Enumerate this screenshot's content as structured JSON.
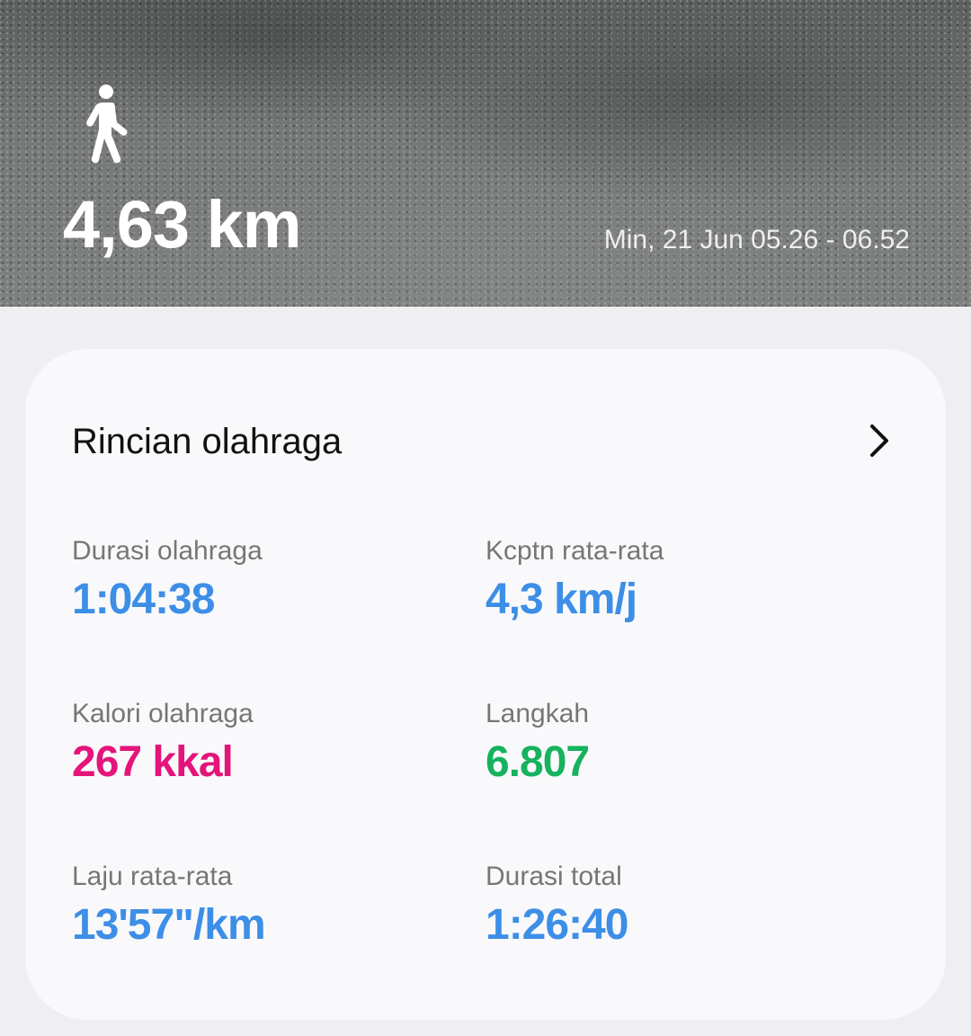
{
  "hero": {
    "activity_icon": "walking-person-icon",
    "distance": "4,63 km",
    "datetime": "Min, 21 Jun 05.26 - 06.52"
  },
  "details": {
    "title": "Rincian olahraga",
    "chevron_icon": "chevron-right-icon",
    "metrics": [
      {
        "label": "Durasi olahraga",
        "value": "1:04:38",
        "color": "#3d8ee6"
      },
      {
        "label": "Kcptn rata-rata",
        "value": "4,3 km/j",
        "color": "#3d8ee6"
      },
      {
        "label": "Kalori olahraga",
        "value": "267 kkal",
        "color": "#e4147a"
      },
      {
        "label": "Langkah",
        "value": "6.807",
        "color": "#16b25f"
      },
      {
        "label": "Laju rata-rata",
        "value": "13'57\"/km",
        "color": "#3d8ee6"
      },
      {
        "label": "Durasi total",
        "value": "1:26:40",
        "color": "#3d8ee6"
      }
    ]
  },
  "colors": {
    "page_background": "#efeff1",
    "card_background": "#f9f9fb",
    "label_gray": "#767676"
  }
}
